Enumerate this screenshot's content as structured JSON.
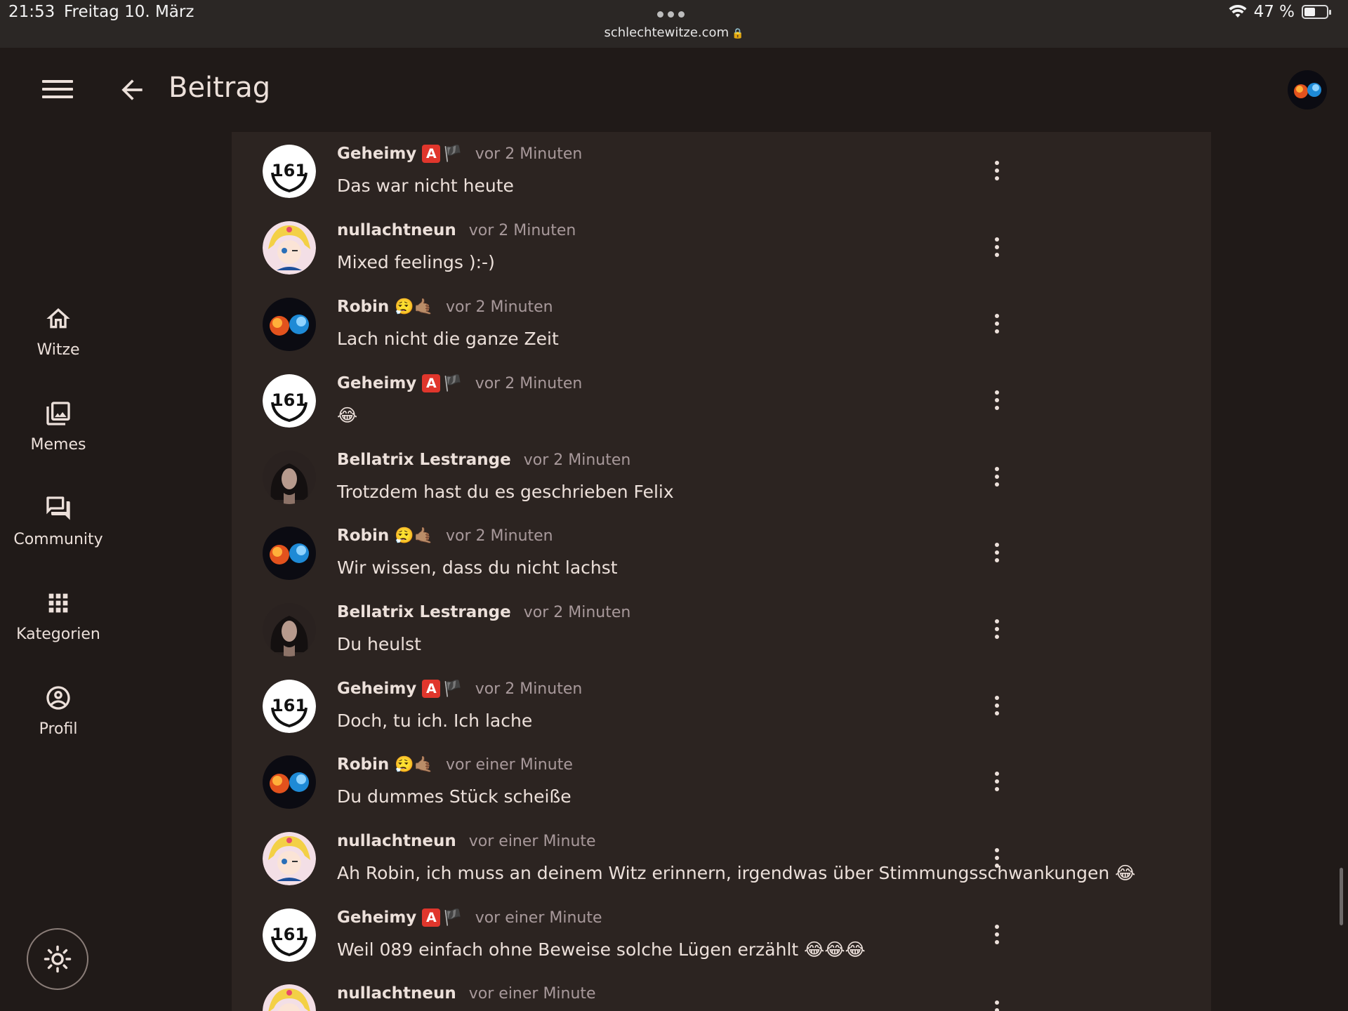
{
  "status_bar": {
    "time": "21:53",
    "date": "Freitag 10. März",
    "url": "schlechtewitze.com",
    "battery": "47 %"
  },
  "app_bar": {
    "title": "Beitrag"
  },
  "nav": {
    "items": [
      {
        "label": "Witze",
        "icon": "home-icon"
      },
      {
        "label": "Memes",
        "icon": "images-icon"
      },
      {
        "label": "Community",
        "icon": "forum-icon"
      },
      {
        "label": "Kategorien",
        "icon": "apps-grid-icon"
      },
      {
        "label": "Profil",
        "icon": "account-circle-icon"
      }
    ]
  },
  "comments": [
    {
      "name": "Geheimy",
      "badges": "🅰️🏴",
      "time": "vor 2 Minuten",
      "text": "Das war nicht heute",
      "avatar": "geheimy"
    },
    {
      "name": "nullachtneun",
      "badges": "",
      "time": "vor 2 Minuten",
      "text": "Mixed feelings ):-)",
      "avatar": "nullachtneun"
    },
    {
      "name": "Robin",
      "badges": "😮‍💨🤙🏽",
      "time": "vor 2 Minuten",
      "text": "Lach nicht die ganze Zeit",
      "avatar": "robin"
    },
    {
      "name": "Geheimy",
      "badges": "🅰️🏴",
      "time": "vor 2 Minuten",
      "text": "😂",
      "avatar": "geheimy"
    },
    {
      "name": "Bellatrix Lestrange",
      "badges": "",
      "time": "vor 2 Minuten",
      "text": "Trotzdem hast du es geschrieben Felix",
      "avatar": "bellatrix"
    },
    {
      "name": "Robin",
      "badges": "😮‍💨🤙🏽",
      "time": "vor 2 Minuten",
      "text": "Wir wissen, dass du nicht lachst",
      "avatar": "robin"
    },
    {
      "name": "Bellatrix Lestrange",
      "badges": "",
      "time": "vor 2 Minuten",
      "text": "Du heulst",
      "avatar": "bellatrix"
    },
    {
      "name": "Geheimy",
      "badges": "🅰️🏴",
      "time": "vor 2 Minuten",
      "text": "Doch, tu ich. Ich lache",
      "avatar": "geheimy"
    },
    {
      "name": "Robin",
      "badges": "😮‍💨🤙🏽",
      "time": "vor einer Minute",
      "text": "Du dummes Stück scheiße",
      "avatar": "robin"
    },
    {
      "name": "nullachtneun",
      "badges": "",
      "time": "vor einer Minute",
      "text": "Ah Robin, ich muss an deinem Witz erinnern, irgendwas über Stimmungsschwankungen 😂",
      "avatar": "nullachtneun"
    },
    {
      "name": "Geheimy",
      "badges": "🅰️🏴",
      "time": "vor einer Minute",
      "text": "Weil 089 einfach ohne Beweise solche Lügen erzählt 😂😂😂",
      "avatar": "geheimy"
    },
    {
      "name": "nullachtneun",
      "badges": "",
      "time": "vor einer Minute",
      "text": "",
      "avatar": "nullachtneun"
    }
  ],
  "avatar_text": {
    "geheimy_badge": "161"
  },
  "colors": {
    "background": "#201a18",
    "panel": "#2c2421",
    "text": "#ece0da",
    "muted": "#a8999b",
    "badge_red": "#e0362c"
  }
}
